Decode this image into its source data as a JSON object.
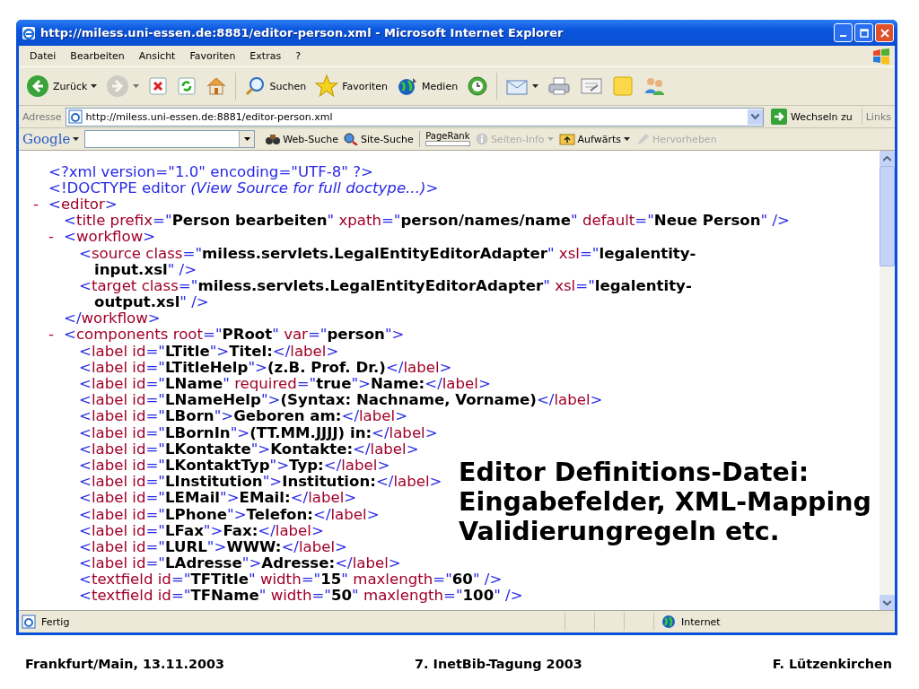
{
  "window": {
    "title": "http://miless.uni-essen.de:8881/editor-person.xml - Microsoft Internet Explorer"
  },
  "menu": [
    "Datei",
    "Bearbeiten",
    "Ansicht",
    "Favoriten",
    "Extras",
    "?"
  ],
  "toolbar": [
    {
      "kind": "back",
      "label": "Zurück",
      "dropdown": true,
      "disabled": false
    },
    {
      "kind": "forward",
      "dropdown": true,
      "disabled": true
    },
    {
      "kind": "stop",
      "dropdown": false,
      "disabled": false
    },
    {
      "kind": "refresh",
      "dropdown": false,
      "disabled": false
    },
    {
      "kind": "home",
      "dropdown": false,
      "disabled": false
    },
    {
      "kind": "search",
      "label": "Suchen",
      "dropdown": false,
      "disabled": false
    },
    {
      "kind": "favorites",
      "label": "Favoriten",
      "dropdown": false,
      "disabled": false
    },
    {
      "kind": "media",
      "label": "Medien",
      "dropdown": false,
      "disabled": false
    },
    {
      "kind": "history",
      "dropdown": false,
      "disabled": false
    },
    {
      "kind": "mail",
      "dropdown": true,
      "disabled": false
    },
    {
      "kind": "print",
      "dropdown": false,
      "disabled": false
    },
    {
      "kind": "edit",
      "dropdown": false,
      "disabled": false
    },
    {
      "kind": "note",
      "dropdown": false,
      "disabled": false
    },
    {
      "kind": "people",
      "dropdown": false,
      "disabled": false
    }
  ],
  "address_bar": {
    "label": "Adresse",
    "value": "http://miless.uni-essen.de:8881/editor-person.xml",
    "go": "Wechseln zu",
    "links": "Links"
  },
  "google_bar": {
    "logo": "Google",
    "items": [
      {
        "kind": "search",
        "label": "Web-Suche",
        "disabled": false
      },
      {
        "kind": "site",
        "label": "Site-Suche",
        "disabled": false
      },
      {
        "kind": "pagerank",
        "label": "PageRank",
        "disabled": false
      },
      {
        "kind": "info",
        "label": "Seiten-Info",
        "disabled": true
      },
      {
        "kind": "up",
        "label": "Aufwärts",
        "disabled": false
      },
      {
        "kind": "highlight",
        "label": "Hervorheben",
        "disabled": true
      }
    ]
  },
  "xml": [
    {
      "lines": [
        [
          {
            "kind": "m",
            "text": "<?xml version=\"1.0\" encoding=\"UTF-8\" ?>"
          }
        ]
      ]
    },
    {
      "lines": [
        [
          {
            "kind": "m",
            "text": "<!DOCTYPE editor "
          },
          {
            "kind": "c",
            "text": "(View Source for full doctype...)"
          },
          {
            "kind": "m",
            "text": ">"
          }
        ]
      ]
    },
    {
      "toggle": "-",
      "lines": [
        [
          {
            "kind": "m",
            "text": "<"
          },
          {
            "kind": "n",
            "text": "editor"
          },
          {
            "kind": "m",
            "text": ">"
          }
        ]
      ],
      "children": [
        {
          "lines": [
            [
              {
                "kind": "m",
                "text": "<"
              },
              {
                "kind": "n",
                "text": "title prefix"
              },
              {
                "kind": "m",
                "text": "=\""
              },
              {
                "kind": "v",
                "text": "Person bearbeiten"
              },
              {
                "kind": "m",
                "text": "\" "
              },
              {
                "kind": "n",
                "text": "xpath"
              },
              {
                "kind": "m",
                "text": "=\""
              },
              {
                "kind": "v",
                "text": "person/names/name"
              },
              {
                "kind": "m",
                "text": "\" "
              },
              {
                "kind": "n",
                "text": "default"
              },
              {
                "kind": "m",
                "text": "=\""
              },
              {
                "kind": "v",
                "text": "Neue Person"
              },
              {
                "kind": "m",
                "text": "\" />"
              }
            ]
          ]
        },
        {
          "toggle": "-",
          "lines": [
            [
              {
                "kind": "m",
                "text": "<"
              },
              {
                "kind": "n",
                "text": "workflow"
              },
              {
                "kind": "m",
                "text": ">"
              }
            ]
          ],
          "close": [
            {
              "kind": "m",
              "text": "</"
            },
            {
              "kind": "n",
              "text": "workflow"
            },
            {
              "kind": "m",
              "text": ">"
            }
          ],
          "children": [
            {
              "lines": [
                [
                  {
                    "kind": "m",
                    "text": "<"
                  },
                  {
                    "kind": "n",
                    "text": "source class"
                  },
                  {
                    "kind": "m",
                    "text": "=\""
                  },
                  {
                    "kind": "v",
                    "text": "miless.servlets.LegalEntityEditorAdapter"
                  },
                  {
                    "kind": "m",
                    "text": "\" "
                  },
                  {
                    "kind": "n",
                    "text": "xsl"
                  },
                  {
                    "kind": "m",
                    "text": "=\""
                  },
                  {
                    "kind": "v",
                    "text": "legalentity-"
                  }
                ],
                [
                  {
                    "kind": "v",
                    "text": "input.xsl"
                  },
                  {
                    "kind": "m",
                    "text": "\" />"
                  }
                ]
              ]
            },
            {
              "lines": [
                [
                  {
                    "kind": "m",
                    "text": "<"
                  },
                  {
                    "kind": "n",
                    "text": "target class"
                  },
                  {
                    "kind": "m",
                    "text": "=\""
                  },
                  {
                    "kind": "v",
                    "text": "miless.servlets.LegalEntityEditorAdapter"
                  },
                  {
                    "kind": "m",
                    "text": "\" "
                  },
                  {
                    "kind": "n",
                    "text": "xsl"
                  },
                  {
                    "kind": "m",
                    "text": "=\""
                  },
                  {
                    "kind": "v",
                    "text": "legalentity-"
                  }
                ],
                [
                  {
                    "kind": "v",
                    "text": "output.xsl"
                  },
                  {
                    "kind": "m",
                    "text": "\" />"
                  }
                ]
              ]
            }
          ]
        },
        {
          "toggle": "-",
          "lines": [
            [
              {
                "kind": "m",
                "text": "<"
              },
              {
                "kind": "n",
                "text": "components root"
              },
              {
                "kind": "m",
                "text": "=\""
              },
              {
                "kind": "v",
                "text": "PRoot"
              },
              {
                "kind": "m",
                "text": "\" "
              },
              {
                "kind": "n",
                "text": "var"
              },
              {
                "kind": "m",
                "text": "=\""
              },
              {
                "kind": "v",
                "text": "person"
              },
              {
                "kind": "m",
                "text": "\">"
              }
            ]
          ],
          "children": [
            {
              "lines": [
                [
                  {
                    "kind": "m",
                    "text": "<"
                  },
                  {
                    "kind": "n",
                    "text": "label id"
                  },
                  {
                    "kind": "m",
                    "text": "=\""
                  },
                  {
                    "kind": "v",
                    "text": "LTitle"
                  },
                  {
                    "kind": "m",
                    "text": "\">"
                  },
                  {
                    "kind": "v",
                    "text": "Titel:"
                  },
                  {
                    "kind": "m",
                    "text": "</"
                  },
                  {
                    "kind": "n",
                    "text": "label"
                  },
                  {
                    "kind": "m",
                    "text": ">"
                  }
                ]
              ]
            },
            {
              "lines": [
                [
                  {
                    "kind": "m",
                    "text": "<"
                  },
                  {
                    "kind": "n",
                    "text": "label id"
                  },
                  {
                    "kind": "m",
                    "text": "=\""
                  },
                  {
                    "kind": "v",
                    "text": "LTitleHelp"
                  },
                  {
                    "kind": "m",
                    "text": "\">"
                  },
                  {
                    "kind": "v",
                    "text": "(z.B. Prof. Dr.)"
                  },
                  {
                    "kind": "m",
                    "text": "</"
                  },
                  {
                    "kind": "n",
                    "text": "label"
                  },
                  {
                    "kind": "m",
                    "text": ">"
                  }
                ]
              ]
            },
            {
              "lines": [
                [
                  {
                    "kind": "m",
                    "text": "<"
                  },
                  {
                    "kind": "n",
                    "text": "label id"
                  },
                  {
                    "kind": "m",
                    "text": "=\""
                  },
                  {
                    "kind": "v",
                    "text": "LName"
                  },
                  {
                    "kind": "m",
                    "text": "\" "
                  },
                  {
                    "kind": "n",
                    "text": "required"
                  },
                  {
                    "kind": "m",
                    "text": "=\""
                  },
                  {
                    "kind": "v",
                    "text": "true"
                  },
                  {
                    "kind": "m",
                    "text": "\">"
                  },
                  {
                    "kind": "v",
                    "text": "Name:"
                  },
                  {
                    "kind": "m",
                    "text": "</"
                  },
                  {
                    "kind": "n",
                    "text": "label"
                  },
                  {
                    "kind": "m",
                    "text": ">"
                  }
                ]
              ]
            },
            {
              "lines": [
                [
                  {
                    "kind": "m",
                    "text": "<"
                  },
                  {
                    "kind": "n",
                    "text": "label id"
                  },
                  {
                    "kind": "m",
                    "text": "=\""
                  },
                  {
                    "kind": "v",
                    "text": "LNameHelp"
                  },
                  {
                    "kind": "m",
                    "text": "\">"
                  },
                  {
                    "kind": "v",
                    "text": "(Syntax: Nachname, Vorname)"
                  },
                  {
                    "kind": "m",
                    "text": "</"
                  },
                  {
                    "kind": "n",
                    "text": "label"
                  },
                  {
                    "kind": "m",
                    "text": ">"
                  }
                ]
              ]
            },
            {
              "lines": [
                [
                  {
                    "kind": "m",
                    "text": "<"
                  },
                  {
                    "kind": "n",
                    "text": "label id"
                  },
                  {
                    "kind": "m",
                    "text": "=\""
                  },
                  {
                    "kind": "v",
                    "text": "LBorn"
                  },
                  {
                    "kind": "m",
                    "text": "\">"
                  },
                  {
                    "kind": "v",
                    "text": "Geboren am:"
                  },
                  {
                    "kind": "m",
                    "text": "</"
                  },
                  {
                    "kind": "n",
                    "text": "label"
                  },
                  {
                    "kind": "m",
                    "text": ">"
                  }
                ]
              ]
            },
            {
              "lines": [
                [
                  {
                    "kind": "m",
                    "text": "<"
                  },
                  {
                    "kind": "n",
                    "text": "label id"
                  },
                  {
                    "kind": "m",
                    "text": "=\""
                  },
                  {
                    "kind": "v",
                    "text": "LBornIn"
                  },
                  {
                    "kind": "m",
                    "text": "\">"
                  },
                  {
                    "kind": "v",
                    "text": "(TT.MM.JJJJ) in:"
                  },
                  {
                    "kind": "m",
                    "text": "</"
                  },
                  {
                    "kind": "n",
                    "text": "label"
                  },
                  {
                    "kind": "m",
                    "text": ">"
                  }
                ]
              ]
            },
            {
              "lines": [
                [
                  {
                    "kind": "m",
                    "text": "<"
                  },
                  {
                    "kind": "n",
                    "text": "label id"
                  },
                  {
                    "kind": "m",
                    "text": "=\""
                  },
                  {
                    "kind": "v",
                    "text": "LKontakte"
                  },
                  {
                    "kind": "m",
                    "text": "\">"
                  },
                  {
                    "kind": "v",
                    "text": "Kontakte:"
                  },
                  {
                    "kind": "m",
                    "text": "</"
                  },
                  {
                    "kind": "n",
                    "text": "label"
                  },
                  {
                    "kind": "m",
                    "text": ">"
                  }
                ]
              ]
            },
            {
              "lines": [
                [
                  {
                    "kind": "m",
                    "text": "<"
                  },
                  {
                    "kind": "n",
                    "text": "label id"
                  },
                  {
                    "kind": "m",
                    "text": "=\""
                  },
                  {
                    "kind": "v",
                    "text": "LKontaktTyp"
                  },
                  {
                    "kind": "m",
                    "text": "\">"
                  },
                  {
                    "kind": "v",
                    "text": "Typ:"
                  },
                  {
                    "kind": "m",
                    "text": "</"
                  },
                  {
                    "kind": "n",
                    "text": "label"
                  },
                  {
                    "kind": "m",
                    "text": ">"
                  }
                ]
              ]
            },
            {
              "lines": [
                [
                  {
                    "kind": "m",
                    "text": "<"
                  },
                  {
                    "kind": "n",
                    "text": "label id"
                  },
                  {
                    "kind": "m",
                    "text": "=\""
                  },
                  {
                    "kind": "v",
                    "text": "LInstitution"
                  },
                  {
                    "kind": "m",
                    "text": "\">"
                  },
                  {
                    "kind": "v",
                    "text": "Institution:"
                  },
                  {
                    "kind": "m",
                    "text": "</"
                  },
                  {
                    "kind": "n",
                    "text": "label"
                  },
                  {
                    "kind": "m",
                    "text": ">"
                  }
                ]
              ]
            },
            {
              "lines": [
                [
                  {
                    "kind": "m",
                    "text": "<"
                  },
                  {
                    "kind": "n",
                    "text": "label id"
                  },
                  {
                    "kind": "m",
                    "text": "=\""
                  },
                  {
                    "kind": "v",
                    "text": "LEMail"
                  },
                  {
                    "kind": "m",
                    "text": "\">"
                  },
                  {
                    "kind": "v",
                    "text": "EMail:"
                  },
                  {
                    "kind": "m",
                    "text": "</"
                  },
                  {
                    "kind": "n",
                    "text": "label"
                  },
                  {
                    "kind": "m",
                    "text": ">"
                  }
                ]
              ]
            },
            {
              "lines": [
                [
                  {
                    "kind": "m",
                    "text": "<"
                  },
                  {
                    "kind": "n",
                    "text": "label id"
                  },
                  {
                    "kind": "m",
                    "text": "=\""
                  },
                  {
                    "kind": "v",
                    "text": "LPhone"
                  },
                  {
                    "kind": "m",
                    "text": "\">"
                  },
                  {
                    "kind": "v",
                    "text": "Telefon:"
                  },
                  {
                    "kind": "m",
                    "text": "</"
                  },
                  {
                    "kind": "n",
                    "text": "label"
                  },
                  {
                    "kind": "m",
                    "text": ">"
                  }
                ]
              ]
            },
            {
              "lines": [
                [
                  {
                    "kind": "m",
                    "text": "<"
                  },
                  {
                    "kind": "n",
                    "text": "label id"
                  },
                  {
                    "kind": "m",
                    "text": "=\""
                  },
                  {
                    "kind": "v",
                    "text": "LFax"
                  },
                  {
                    "kind": "m",
                    "text": "\">"
                  },
                  {
                    "kind": "v",
                    "text": "Fax:"
                  },
                  {
                    "kind": "m",
                    "text": "</"
                  },
                  {
                    "kind": "n",
                    "text": "label"
                  },
                  {
                    "kind": "m",
                    "text": ">"
                  }
                ]
              ]
            },
            {
              "lines": [
                [
                  {
                    "kind": "m",
                    "text": "<"
                  },
                  {
                    "kind": "n",
                    "text": "label id"
                  },
                  {
                    "kind": "m",
                    "text": "=\""
                  },
                  {
                    "kind": "v",
                    "text": "LURL"
                  },
                  {
                    "kind": "m",
                    "text": "\">"
                  },
                  {
                    "kind": "v",
                    "text": "WWW:"
                  },
                  {
                    "kind": "m",
                    "text": "</"
                  },
                  {
                    "kind": "n",
                    "text": "label"
                  },
                  {
                    "kind": "m",
                    "text": ">"
                  }
                ]
              ]
            },
            {
              "lines": [
                [
                  {
                    "kind": "m",
                    "text": "<"
                  },
                  {
                    "kind": "n",
                    "text": "label id"
                  },
                  {
                    "kind": "m",
                    "text": "=\""
                  },
                  {
                    "kind": "v",
                    "text": "LAdresse"
                  },
                  {
                    "kind": "m",
                    "text": "\">"
                  },
                  {
                    "kind": "v",
                    "text": "Adresse:"
                  },
                  {
                    "kind": "m",
                    "text": "</"
                  },
                  {
                    "kind": "n",
                    "text": "label"
                  },
                  {
                    "kind": "m",
                    "text": ">"
                  }
                ]
              ]
            },
            {
              "lines": [
                [
                  {
                    "kind": "m",
                    "text": "<"
                  },
                  {
                    "kind": "n",
                    "text": "textfield id"
                  },
                  {
                    "kind": "m",
                    "text": "=\""
                  },
                  {
                    "kind": "v",
                    "text": "TFTitle"
                  },
                  {
                    "kind": "m",
                    "text": "\" "
                  },
                  {
                    "kind": "n",
                    "text": "width"
                  },
                  {
                    "kind": "m",
                    "text": "=\""
                  },
                  {
                    "kind": "v",
                    "text": "15"
                  },
                  {
                    "kind": "m",
                    "text": "\" "
                  },
                  {
                    "kind": "n",
                    "text": "maxlength"
                  },
                  {
                    "kind": "m",
                    "text": "=\""
                  },
                  {
                    "kind": "v",
                    "text": "60"
                  },
                  {
                    "kind": "m",
                    "text": "\" />"
                  }
                ]
              ]
            },
            {
              "lines": [
                [
                  {
                    "kind": "m",
                    "text": "<"
                  },
                  {
                    "kind": "n",
                    "text": "textfield id"
                  },
                  {
                    "kind": "m",
                    "text": "=\""
                  },
                  {
                    "kind": "v",
                    "text": "TFName"
                  },
                  {
                    "kind": "m",
                    "text": "\" "
                  },
                  {
                    "kind": "n",
                    "text": "width"
                  },
                  {
                    "kind": "m",
                    "text": "=\""
                  },
                  {
                    "kind": "v",
                    "text": "50"
                  },
                  {
                    "kind": "m",
                    "text": "\" "
                  },
                  {
                    "kind": "n",
                    "text": "maxlength"
                  },
                  {
                    "kind": "m",
                    "text": "=\""
                  },
                  {
                    "kind": "v",
                    "text": "100"
                  },
                  {
                    "kind": "m",
                    "text": "\" />"
                  }
                ]
              ]
            }
          ]
        }
      ]
    }
  ],
  "overlay_note": [
    "Editor Definitions-Datei:",
    "Eingabefelder, XML-Mapping",
    "Validierungregeln etc."
  ],
  "status_bar": {
    "text": "Fertig",
    "zone": "Internet"
  },
  "footer": [
    "Frankfurt/Main, 13.11.2003",
    "7. InetBib-Tagung 2003",
    "F. Lützenkirchen"
  ]
}
